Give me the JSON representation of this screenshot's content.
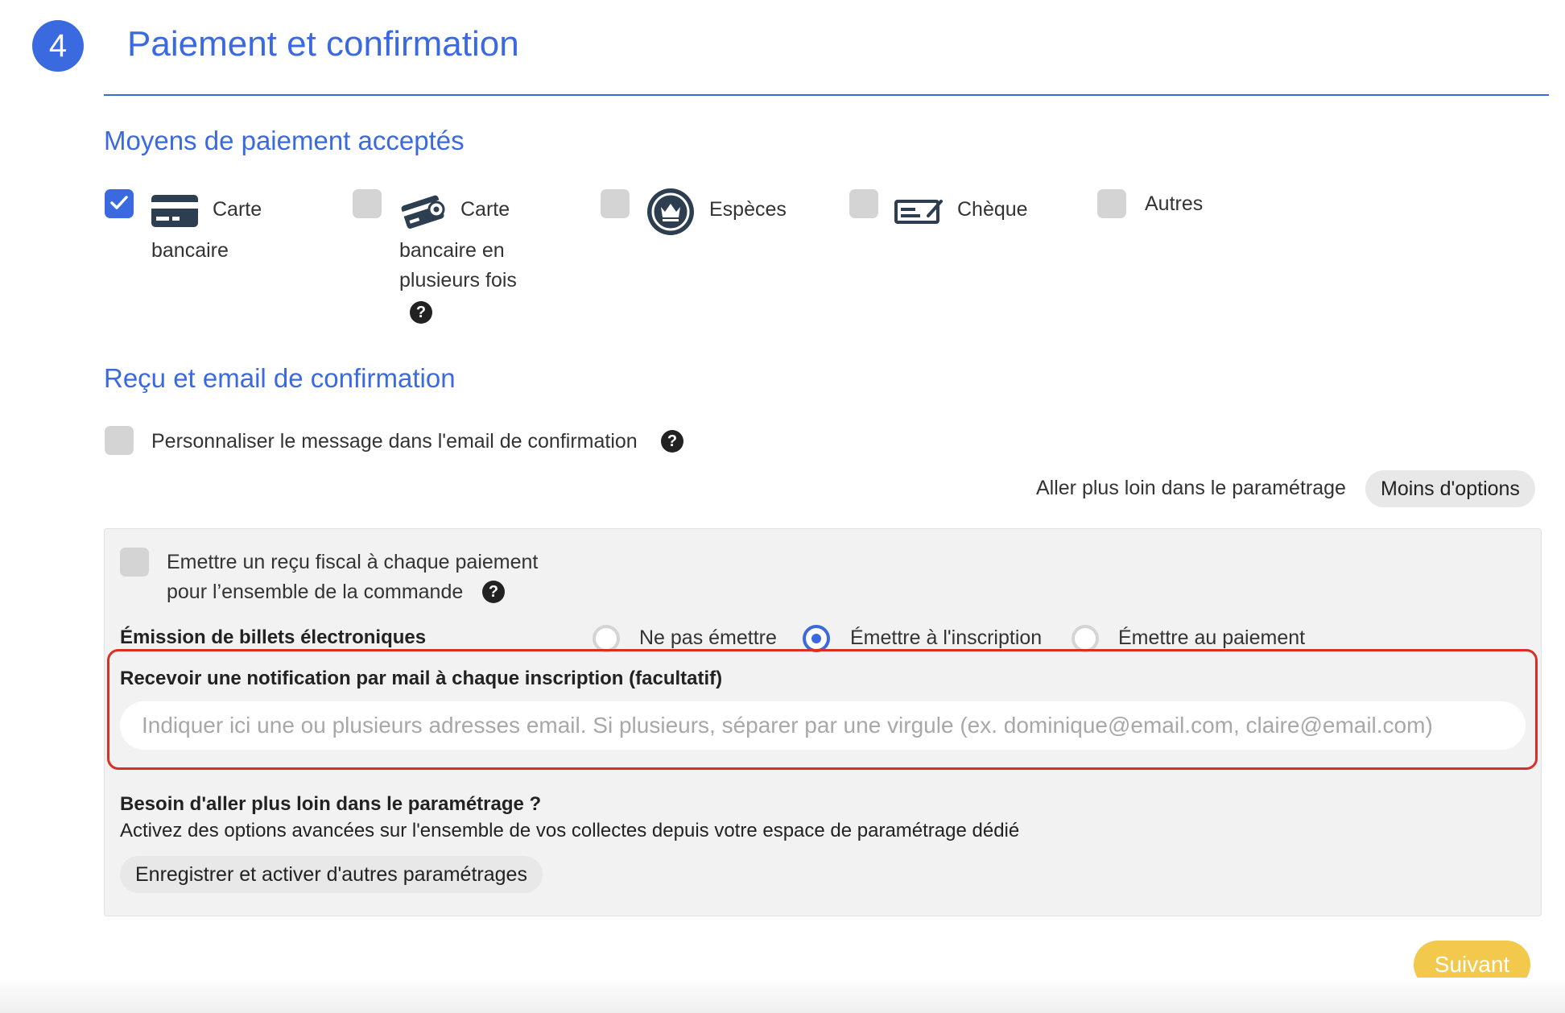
{
  "step": {
    "number": "4",
    "title": "Paiement et confirmation"
  },
  "payment": {
    "heading": "Moyens de paiement acceptés",
    "methods": [
      {
        "line1": "Carte",
        "line2": "bancaire",
        "checked": true,
        "icon": "credit-card-icon"
      },
      {
        "line1": "Carte",
        "line2": "bancaire en",
        "line3": "plusieurs fois",
        "checked": false,
        "icon": "card-installments-icon",
        "help": "?"
      },
      {
        "line1": "Espèces",
        "checked": false,
        "icon": "cash-icon"
      },
      {
        "line1": "Chèque",
        "checked": false,
        "icon": "cheque-icon"
      },
      {
        "line1": "Autres",
        "checked": false
      }
    ]
  },
  "receipt": {
    "heading": "Reçu et email de confirmation",
    "customize_label": "Personnaliser le message dans l'email de confirmation",
    "help": "?",
    "more_settings_label": "Aller plus loin dans le paramétrage",
    "less_options_button": "Moins d'options"
  },
  "panel": {
    "fiscal_line1": "Emettre un reçu fiscal à chaque paiement",
    "fiscal_line2": "pour l’ensemble de la commande",
    "help": "?",
    "tickets_label": "Émission de billets électroniques",
    "ticket_options": [
      {
        "label": "Ne pas émettre",
        "selected": false
      },
      {
        "label": "Émettre à l'inscription",
        "selected": true
      },
      {
        "label": "Émettre au paiement",
        "selected": false
      }
    ],
    "notification_label": "Recevoir une notification par mail à chaque inscription (facultatif)",
    "notification_placeholder": "Indiquer ici une ou plusieurs adresses email. Si plusieurs, séparer par une virgule (ex. dominique@email.com, claire@email.com)",
    "notification_value": "",
    "advanced_title": "Besoin d'aller plus loin dans le paramétrage ?",
    "advanced_text": "Activez des options avancées sur l'ensemble de vos collectes depuis votre espace de paramétrage dédié",
    "advanced_button": "Enregistrer et activer d'autres paramétrages"
  },
  "next_button": "Suivant",
  "colors": {
    "accent": "#3b6ae0",
    "highlight": "#d93025",
    "next": "#f2c94c",
    "checkbox_off": "#d4d4d4"
  }
}
